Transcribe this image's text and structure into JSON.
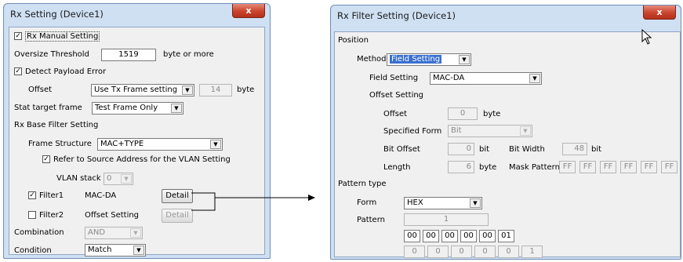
{
  "rx": {
    "title": "Rx Setting (Device1)",
    "close": "x",
    "manual_setting": "Rx Manual Setting",
    "oversize_label": "Oversize Threshold",
    "oversize_value": "1519",
    "oversize_unit": "byte or more",
    "detect_payload": "Detect Payload Error",
    "offset_label": "Offset",
    "offset_select": "Use Tx Frame setting",
    "offset_value": "14",
    "offset_unit": "byte",
    "stat_label": "Stat target frame",
    "stat_select": "Test Frame Only",
    "base_filter": "Rx Base Filter Setting",
    "frame_structure_label": "Frame Structure",
    "frame_structure_value": "MAC+TYPE",
    "refer_source": "Refer to Source Address for the VLAN Setting",
    "vlan_label": "VLAN stack",
    "vlan_value": "0",
    "filter1_label": "Filter1",
    "filter1_value": "MAC-DA",
    "filter2_label": "Filter2",
    "filter2_value": "Offset Setting",
    "detail1": "Detail",
    "detail2": "Detail",
    "combination_label": "Combination",
    "combination_value": "AND",
    "condition_label": "Condition",
    "condition_value": "Match"
  },
  "filter": {
    "title": "Rx Filter Setting (Device1)",
    "close": "x",
    "position": "Position",
    "method_label": "Method",
    "method_value": "Field Setting",
    "field_setting_label": "Field Setting",
    "field_setting_value": "MAC-DA",
    "offset_setting": "Offset Setting",
    "offset_label": "Offset",
    "offset_value": "0",
    "offset_unit": "byte",
    "specified_form_label": "Specified Form",
    "specified_form_value": "Bit",
    "bit_offset_label": "Bit Offset",
    "bit_offset_value": "0",
    "bit_offset_unit": "bit",
    "bit_width_label": "Bit Width",
    "bit_width_value": "48",
    "bit_width_unit": "bit",
    "length_label": "Length",
    "length_value": "6",
    "length_unit": "byte",
    "mask_label": "Mask Pattern",
    "mask_values": [
      "FF",
      "FF",
      "FF",
      "FF",
      "FF",
      "FF"
    ],
    "pattern_type": "Pattern type",
    "form_label": "Form",
    "form_value": "HEX",
    "pattern_label": "Pattern",
    "pattern_value": "1",
    "hex_values": [
      "00",
      "00",
      "00",
      "00",
      "00",
      "01"
    ],
    "dec_values": [
      "0",
      "0",
      "0",
      "0",
      "0",
      "1"
    ]
  },
  "check_mark": "✓",
  "dropdown_arrow": "▼"
}
